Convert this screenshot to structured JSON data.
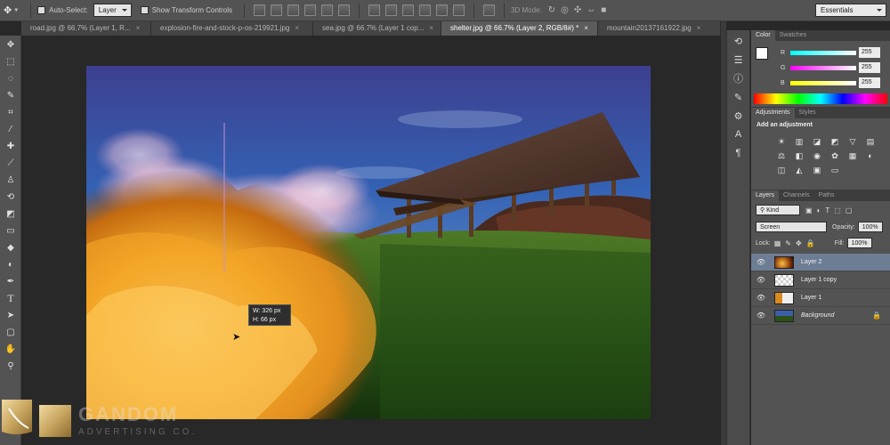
{
  "options_bar": {
    "auto_select_label": "Auto-Select:",
    "auto_select_value": "Layer",
    "show_transform_label": "Show Transform Controls",
    "mode_3d_label": "3D Mode:",
    "workspace": "Essentials"
  },
  "tabs": [
    {
      "label": "road.jpg @ 66.7% (Layer 1, R..."
    },
    {
      "label": "explosion-fire-and-stock-p-os-219921.jpg"
    },
    {
      "label": "sea.jpg @ 66.7% (Layer 1 cop..."
    },
    {
      "label": "shelter.jpg @ 66.7% (Layer 2, RGB/8#) *"
    },
    {
      "label": "mountain20137161922.jpg"
    }
  ],
  "tooltip": {
    "w_label": "W:",
    "w_value": "326 px",
    "h_label": "H:",
    "h_value": "66 px"
  },
  "color_panel": {
    "tabs": [
      "Color",
      "Swatches"
    ],
    "r_label": "R",
    "r_value": "255",
    "g_label": "G",
    "g_value": "255",
    "b_label": "B",
    "b_value": "255",
    "swatch_fg": "#ffffff"
  },
  "adjustments_panel": {
    "tabs": [
      "Adjustments",
      "Styles"
    ],
    "heading": "Add an adjustment"
  },
  "layers_panel": {
    "tabs": [
      "Layers",
      "Channels",
      "Paths"
    ],
    "filter_kind": "Kind",
    "blend_mode": "Screen",
    "opacity_label": "Opacity:",
    "opacity_value": "100%",
    "lock_label": "Lock:",
    "fill_label": "Fill:",
    "fill_value": "100%",
    "layers": [
      {
        "name": "Layer 2",
        "selected": true
      },
      {
        "name": "Layer 1 copy",
        "selected": false
      },
      {
        "name": "Layer 1",
        "selected": false
      },
      {
        "name": "Background",
        "selected": false
      }
    ]
  },
  "watermark": {
    "name": "GANDOM",
    "sub": "ADVERTISING CO."
  },
  "colors": {
    "panel_bg": "#535353",
    "selected_layer": "#6d7d94",
    "accent_gold": "#c9a661"
  }
}
